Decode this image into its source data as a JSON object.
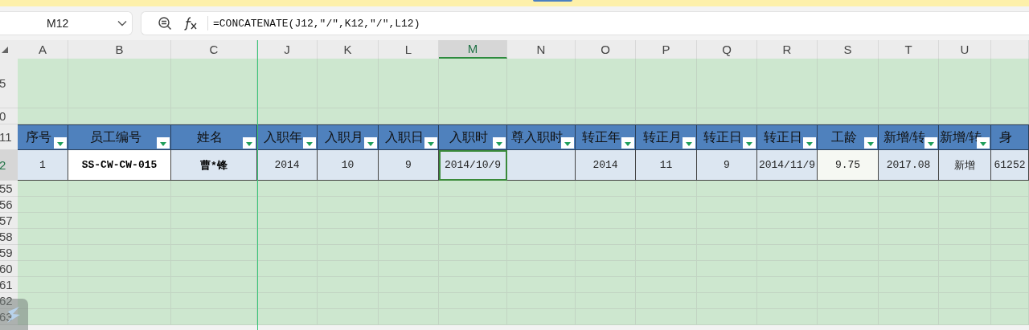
{
  "name_box": "M12",
  "formula": "=CONCATENATE(J12,\"/\",K12,\"/\",L12)",
  "columns": [
    {
      "label": "A",
      "selected": false
    },
    {
      "label": "B",
      "selected": false
    },
    {
      "label": "C",
      "selected": false
    },
    {
      "label": "J",
      "selected": false
    },
    {
      "label": "K",
      "selected": false
    },
    {
      "label": "L",
      "selected": false
    },
    {
      "label": "M",
      "selected": true
    },
    {
      "label": "N",
      "selected": false
    },
    {
      "label": "O",
      "selected": false
    },
    {
      "label": "P",
      "selected": false
    },
    {
      "label": "Q",
      "selected": false
    },
    {
      "label": "R",
      "selected": false
    },
    {
      "label": "S",
      "selected": false
    },
    {
      "label": "T",
      "selected": false
    },
    {
      "label": "U",
      "selected": false
    },
    {
      "selected": false
    }
  ],
  "rows": [
    {
      "number": "5",
      "kind": "spacer",
      "selected": false
    },
    {
      "number": "0",
      "kind": "blank",
      "selected": false
    },
    {
      "number": "11",
      "kind": "header",
      "selected": false,
      "cells": [
        {
          "text": "序号",
          "filter": true
        },
        {
          "text": "员工编号",
          "filter": true
        },
        {
          "text": "姓名",
          "filter": true
        },
        {
          "text": "入职年",
          "filter": true
        },
        {
          "text": "入职月",
          "filter": true
        },
        {
          "text": "入职日",
          "filter": true
        },
        {
          "text": "入职时",
          "filter": true
        },
        {
          "text": "尊入职时",
          "filter": true
        },
        {
          "text": "转正年",
          "filter": true
        },
        {
          "text": "转正月",
          "filter": true
        },
        {
          "text": "转正日",
          "filter": true
        },
        {
          "text": "转正日",
          "filter": true
        },
        {
          "text": "工龄",
          "filter": true
        },
        {
          "text": "新增/转",
          "filter": true
        },
        {
          "text": "新增/转",
          "filter": true
        },
        {
          "text": "身",
          "filter": false
        }
      ]
    },
    {
      "number": "2",
      "kind": "data",
      "selected": true,
      "cells": [
        {
          "text": "1",
          "selected": false,
          "color": "#dce6f1"
        },
        {
          "text": "SS-CW-CW-015",
          "selected": false,
          "color": "#ffffff"
        },
        {
          "text": "曹*锋",
          "selected": false,
          "color": "#dce6f1"
        },
        {
          "text": "2014",
          "selected": false,
          "color": "#dce6f1"
        },
        {
          "text": "10",
          "selected": false,
          "color": "#dce6f1"
        },
        {
          "text": "9",
          "selected": false,
          "color": "#dce6f1"
        },
        {
          "text": "2014/10/9",
          "selected": true,
          "color": "#dce6f1"
        },
        {
          "selected": false,
          "color": "#dce6f1"
        },
        {
          "text": "2014",
          "selected": false,
          "color": "#dce6f1"
        },
        {
          "text": "11",
          "selected": false,
          "color": "#dce6f1"
        },
        {
          "text": "9",
          "selected": false,
          "color": "#dce6f1"
        },
        {
          "text": "2014/11/9",
          "selected": false,
          "color": "#dce6f1"
        },
        {
          "text": "9.75",
          "selected": false,
          "color": "#f6f8f3"
        },
        {
          "text": "2017.08",
          "selected": false,
          "color": "#dce6f1"
        },
        {
          "text": "新增",
          "selected": false,
          "color": "#dce6f1"
        },
        {
          "text": "61252",
          "selected": false,
          "color": "#dce6f1"
        }
      ]
    },
    {
      "number": "55",
      "kind": "blank",
      "selected": false
    },
    {
      "number": "56",
      "kind": "blank",
      "selected": false
    },
    {
      "number": "57",
      "kind": "blank",
      "selected": false
    },
    {
      "number": "58",
      "kind": "blank",
      "selected": false
    },
    {
      "number": "59",
      "kind": "blank",
      "selected": false
    },
    {
      "number": "60",
      "kind": "blank",
      "selected": false
    },
    {
      "number": "61",
      "kind": "blank",
      "selected": false
    },
    {
      "number": "62",
      "kind": "blank",
      "selected": false
    },
    {
      "number": "63",
      "kind": "blank",
      "selected": false
    }
  ]
}
